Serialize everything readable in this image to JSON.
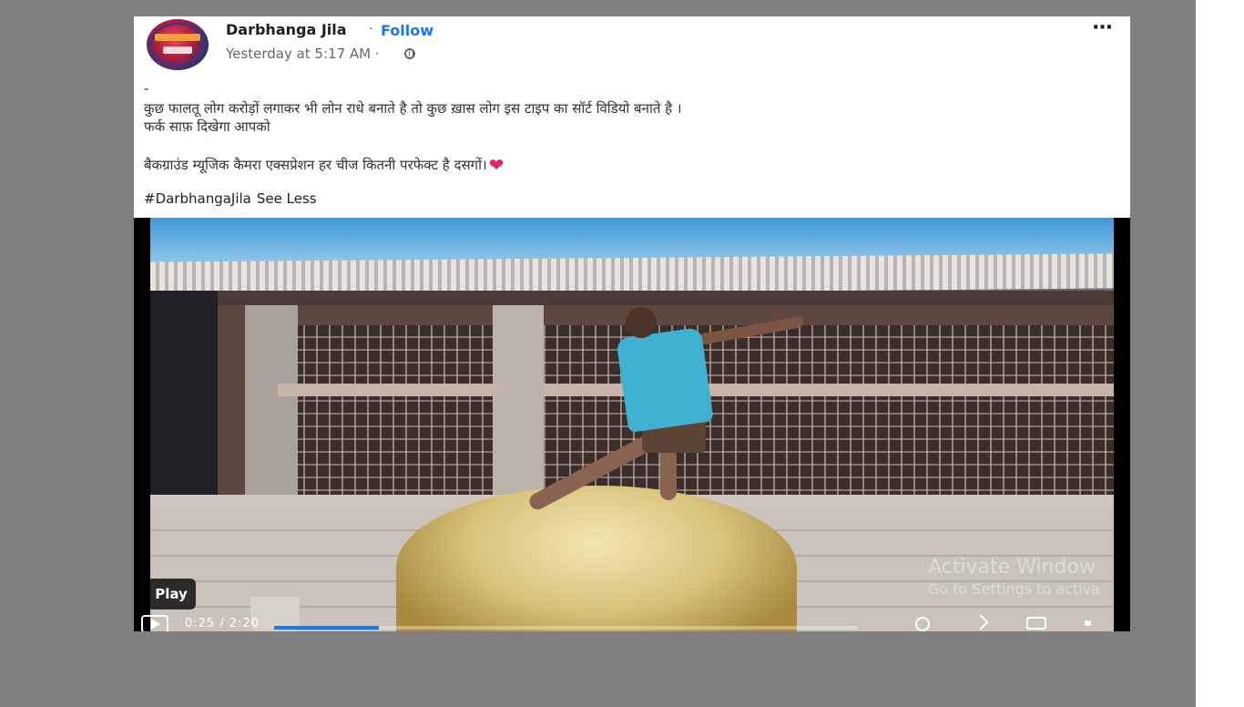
{
  "post": {
    "author": "Darbhanga Jila",
    "separator": "·",
    "follow_label": "Follow",
    "timestamp": "Yesterday at 5:17 AM ·",
    "more_label": "···",
    "lines": [
      "-",
      "कुछ फालतू लोग करोड़ों लगाकर भी लोन राधे बनाते है तो कुछ ख़ास लोग इस टाइप का सॉर्ट विडियो बनाते है ।",
      "फर्क साफ़ दिखेगा आपको",
      "बैकग्राउंड म्यूजिक कैमरा एक्सप्रेशन हर चीज कितनी परफेक्ट है दसगों।"
    ],
    "hashtag": "#DarbhangaJila",
    "see_less": "See Less",
    "heart": "❤"
  },
  "video": {
    "play_badge": "Play",
    "time": "0:25 / 2:20",
    "progress_fraction": 0.18,
    "accent_color": "#1877f2"
  },
  "watermark": {
    "title": "Activate Window",
    "subtitle": "Go to Settings to activa"
  }
}
